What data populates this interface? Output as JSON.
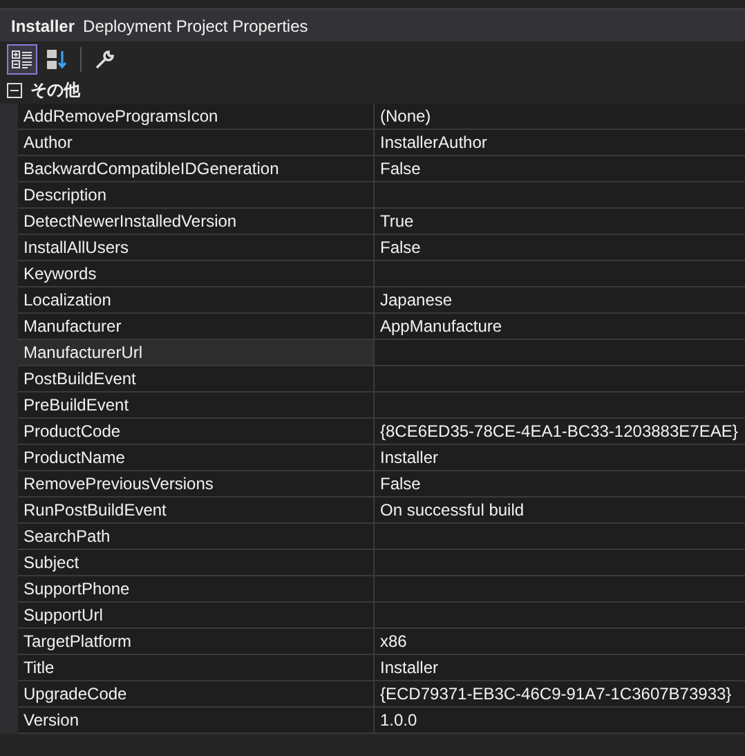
{
  "header": {
    "object": "Installer",
    "type": "Deployment Project Properties"
  },
  "toolbar": [
    {
      "kind": "categorized",
      "selected": true
    },
    {
      "kind": "alphabetical",
      "selected": false
    },
    {
      "kind": "property-pages",
      "selected": false
    }
  ],
  "category": {
    "name": "その他",
    "expanded": true
  },
  "properties": [
    {
      "name": "AddRemoveProgramsIcon",
      "value": "(None)",
      "selected": false
    },
    {
      "name": "Author",
      "value": "InstallerAuthor",
      "selected": false
    },
    {
      "name": "BackwardCompatibleIDGeneration",
      "value": "False",
      "selected": false
    },
    {
      "name": "Description",
      "selected": false
    },
    {
      "name": "DetectNewerInstalledVersion",
      "value": "True",
      "selected": false
    },
    {
      "name": "InstallAllUsers",
      "value": "False",
      "selected": false
    },
    {
      "name": "Keywords",
      "selected": false
    },
    {
      "name": "Localization",
      "value": "Japanese",
      "selected": false
    },
    {
      "name": "Manufacturer",
      "value": "AppManufacture",
      "selected": false
    },
    {
      "name": "ManufacturerUrl",
      "selected": true
    },
    {
      "name": "PostBuildEvent",
      "selected": false
    },
    {
      "name": "PreBuildEvent",
      "selected": false
    },
    {
      "name": "ProductCode",
      "value": "{8CE6ED35-78CE-4EA1-BC33-1203883E7EAE}",
      "selected": false
    },
    {
      "name": "ProductName",
      "value": "Installer",
      "selected": false
    },
    {
      "name": "RemovePreviousVersions",
      "value": "False",
      "selected": false
    },
    {
      "name": "RunPostBuildEvent",
      "value": "On successful build",
      "selected": false
    },
    {
      "name": "SearchPath",
      "selected": false
    },
    {
      "name": "Subject",
      "selected": false
    },
    {
      "name": "SupportPhone",
      "selected": false
    },
    {
      "name": "SupportUrl",
      "selected": false
    },
    {
      "name": "TargetPlatform",
      "value": "x86",
      "selected": false
    },
    {
      "name": "Title",
      "value": "Installer",
      "selected": false
    },
    {
      "name": "UpgradeCode",
      "value": "{ECD79371-EB3C-46C9-91A7-1C3607B73933}",
      "selected": false
    },
    {
      "name": "Version",
      "value": "1.0.0",
      "selected": false
    }
  ]
}
